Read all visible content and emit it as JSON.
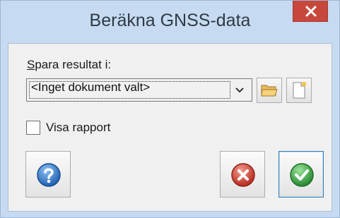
{
  "window": {
    "title": "Beräkna GNSS-data"
  },
  "form": {
    "save_label": "Spara resultat i:",
    "save_mnemonic": "S",
    "save_label_rest": "para resultat i:",
    "document_value": "<Inget dokument valt>",
    "show_report_label": "Visa rapport",
    "show_report_checked": false
  },
  "icons": {
    "close": "close-icon",
    "dropdown": "chevron-down-icon",
    "open_folder": "folder-icon",
    "new_document": "new-document-icon",
    "help": "help-icon",
    "cancel": "cancel-icon",
    "ok": "ok-checkmark-icon"
  },
  "colors": {
    "title_bar": "#c6dbf1",
    "close_button": "#c8473c",
    "help_blue": "#2f6fbf",
    "cancel_red": "#c0392b",
    "ok_green": "#2e9b3a"
  }
}
